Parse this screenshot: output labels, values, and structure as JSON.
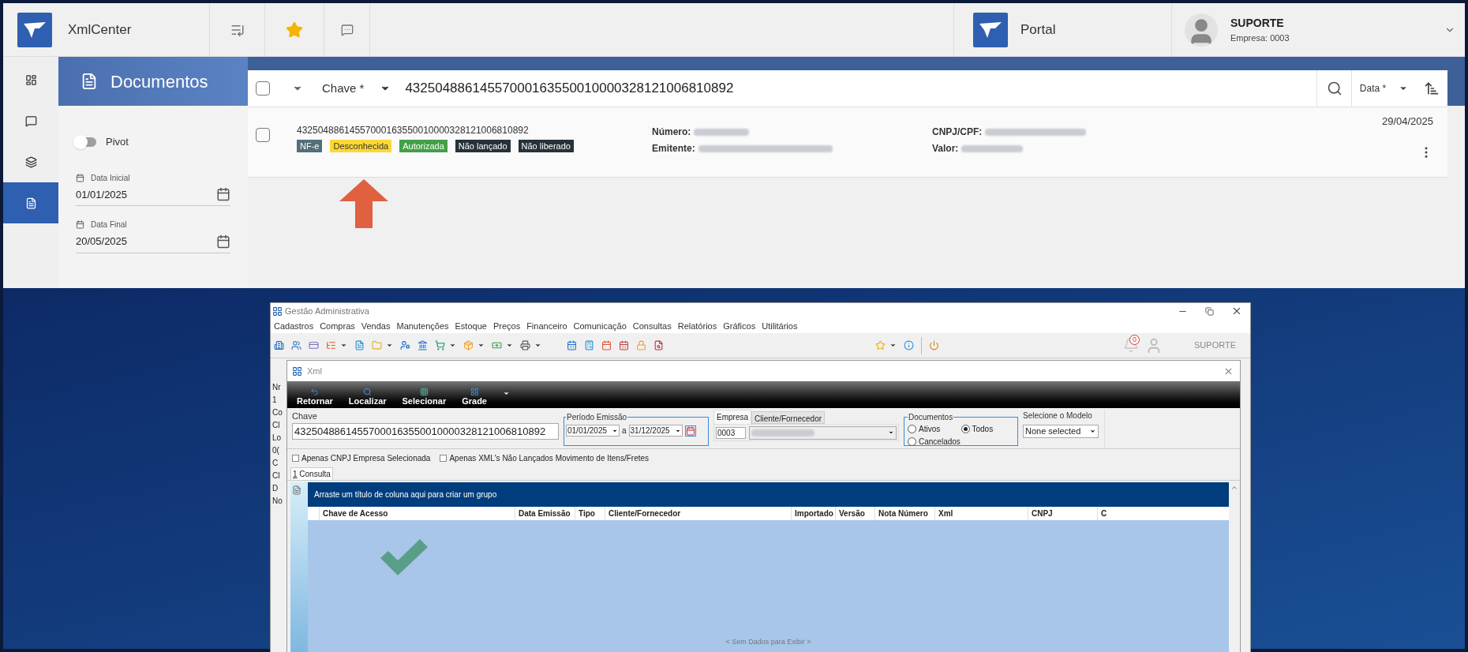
{
  "webapp": {
    "app_name": "XmlCenter",
    "portal_label": "Portal",
    "user": {
      "name": "SUPORTE",
      "company": "Empresa: 0003"
    },
    "side_nav": [
      {
        "kind": "dashboard",
        "selected": false
      },
      {
        "kind": "chat",
        "selected": false
      },
      {
        "kind": "layers",
        "selected": false
      },
      {
        "kind": "document",
        "selected": true
      }
    ],
    "page_title": "Documentos",
    "pivot": {
      "label": "Pivot",
      "on": false
    },
    "date_fields": [
      {
        "label": "Data Inicial",
        "value": "01/01/2025"
      },
      {
        "label": "Data Final",
        "value": "20/05/2025"
      }
    ],
    "search_bar": {
      "checked": false,
      "field": "Chave *",
      "value": "43250488614557000163550010000328121006810892",
      "sort": "Data *"
    },
    "results": [
      {
        "checked": false,
        "key": "43250488614557000163550010000328121006810892",
        "date": "29/04/2025",
        "tags": [
          {
            "label": "NF-e",
            "color": "#546e7a"
          },
          {
            "label": "Desconhecida",
            "color": "#fdd835"
          },
          {
            "label": "Autorizada",
            "color": "#43a047"
          },
          {
            "label": "Não lançado",
            "color": "#263238"
          },
          {
            "label": "Não liberado",
            "color": "#263238"
          }
        ],
        "fields_left": [
          {
            "label": "Número:"
          },
          {
            "label": "Emitente:"
          }
        ],
        "fields_right": [
          {
            "label": "CNPJ/CPF:"
          },
          {
            "label": "Valor:"
          }
        ]
      }
    ]
  },
  "desktop_app": {
    "title": "Gestão Administrativa",
    "menu": [
      "Cadastros",
      "Compras",
      "Vendas",
      "Manutenções",
      "Estoque",
      "Preços",
      "Financeiro",
      "Comunicação",
      "Consultas",
      "Relatórios",
      "Gráficos",
      "Utilitários"
    ],
    "notification_count": "0",
    "user": "SUPORTE",
    "background_labels": [
      "Nr",
      "1",
      "Co",
      "Cl",
      "Lo",
      "0(",
      "C",
      "Cl",
      "D",
      "No"
    ],
    "xml_window": {
      "title": "Xml",
      "toolbar": [
        "Retornar",
        "Localizar",
        "Selecionar",
        "Grade"
      ],
      "chave": {
        "label": "Chave",
        "value": "43250488614557000163550010000328121006810892"
      },
      "periodo": {
        "label": "Período Emissão",
        "from": "01/01/2025",
        "separator": "a",
        "to": "31/12/2025"
      },
      "party_tabs": [
        {
          "label": "Empresa",
          "selected": true
        },
        {
          "label": "Cliente/Fornecedor",
          "selected": false
        }
      ],
      "empresa_value": "0003",
      "documentos": {
        "label": "Documentos",
        "options": [
          {
            "label": "Ativos",
            "selected": false
          },
          {
            "label": "Todos",
            "selected": true
          },
          {
            "label": "Cancelados",
            "selected": false
          }
        ]
      },
      "modelo": {
        "label": "Selecione o Modelo",
        "value": "None selected"
      },
      "checkboxes": [
        {
          "label": "Apenas CNPJ Empresa Selecionada",
          "checked": false
        },
        {
          "label": "Apenas XML's Não Lançados Movimento de Itens/Fretes",
          "checked": false
        }
      ],
      "tabs": [
        {
          "label": "1 Consulta",
          "selected": true
        }
      ],
      "group_hint": "Arraste um título de coluna aqui para criar um grupo",
      "columns": [
        "Chave de Acesso",
        "Data Emissão",
        "Tipo",
        "Cliente/Fornecedor",
        "Importado",
        "Versão",
        "Nota Número",
        "Xml",
        "CNPJ",
        "C"
      ],
      "empty_text": "< Sem Dados para Exibir >"
    }
  }
}
